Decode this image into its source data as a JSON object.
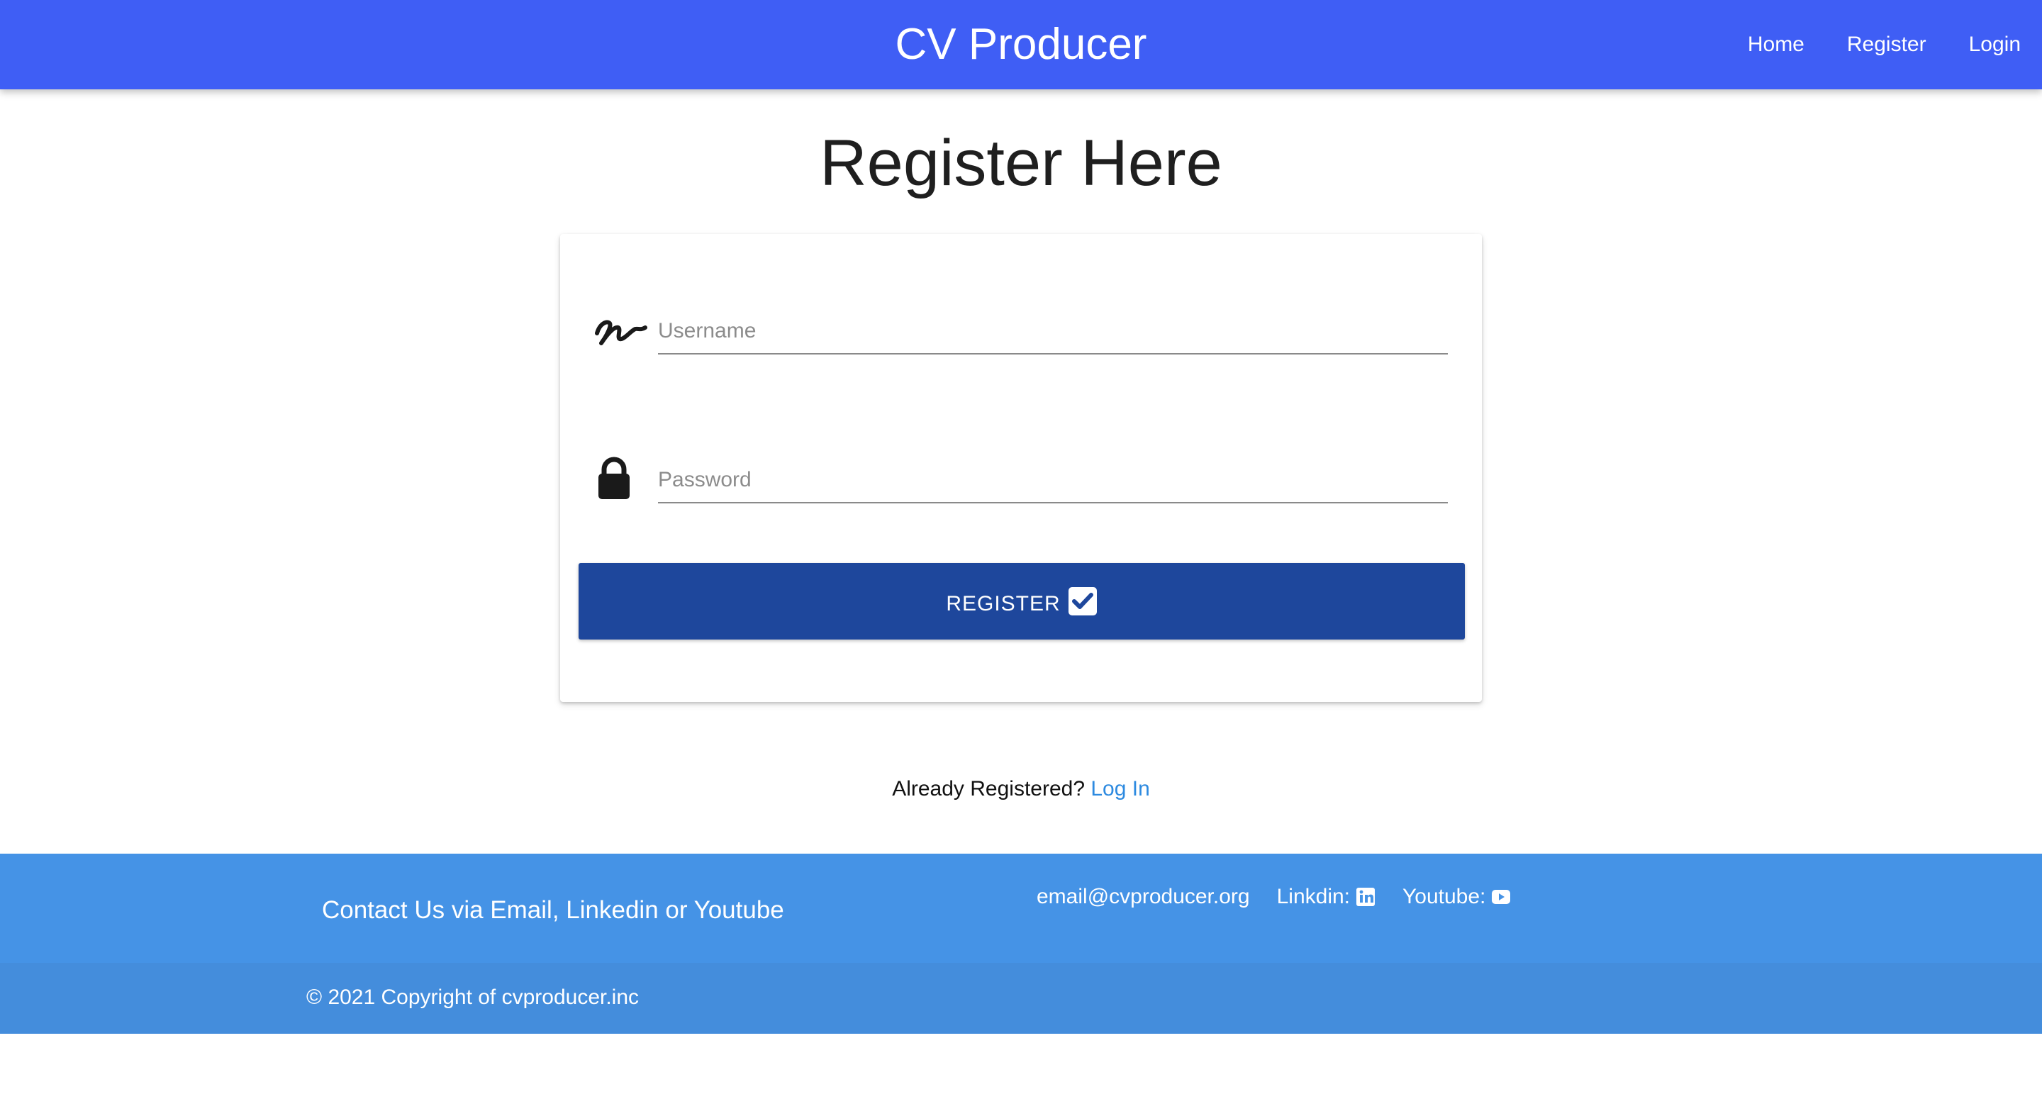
{
  "navbar": {
    "brand": "CV Producer",
    "links": [
      "Home",
      "Register",
      "Login"
    ]
  },
  "page": {
    "title": "Register Here"
  },
  "form": {
    "username_placeholder": "Username",
    "password_placeholder": "Password",
    "register_label": "REGISTER",
    "icons": [
      "signature-icon",
      "lock-icon",
      "check-square-icon"
    ]
  },
  "already": {
    "text": "Already Registered?",
    "link": "Log In"
  },
  "footer": {
    "contact": "Contact Us via Email, Linkedin or Youtube",
    "email": "email@cvproducer.org",
    "linkedin": "Linkdin:",
    "youtube": "Youtube:",
    "copyright": "© 2021 Copyright of cvproducer.inc"
  },
  "colors": {
    "navbar": "#3f5ef5",
    "button": "#1e479c",
    "footer_top": "#4593e6",
    "footer_bottom": "#448ddc",
    "link": "#2d8ae0"
  }
}
